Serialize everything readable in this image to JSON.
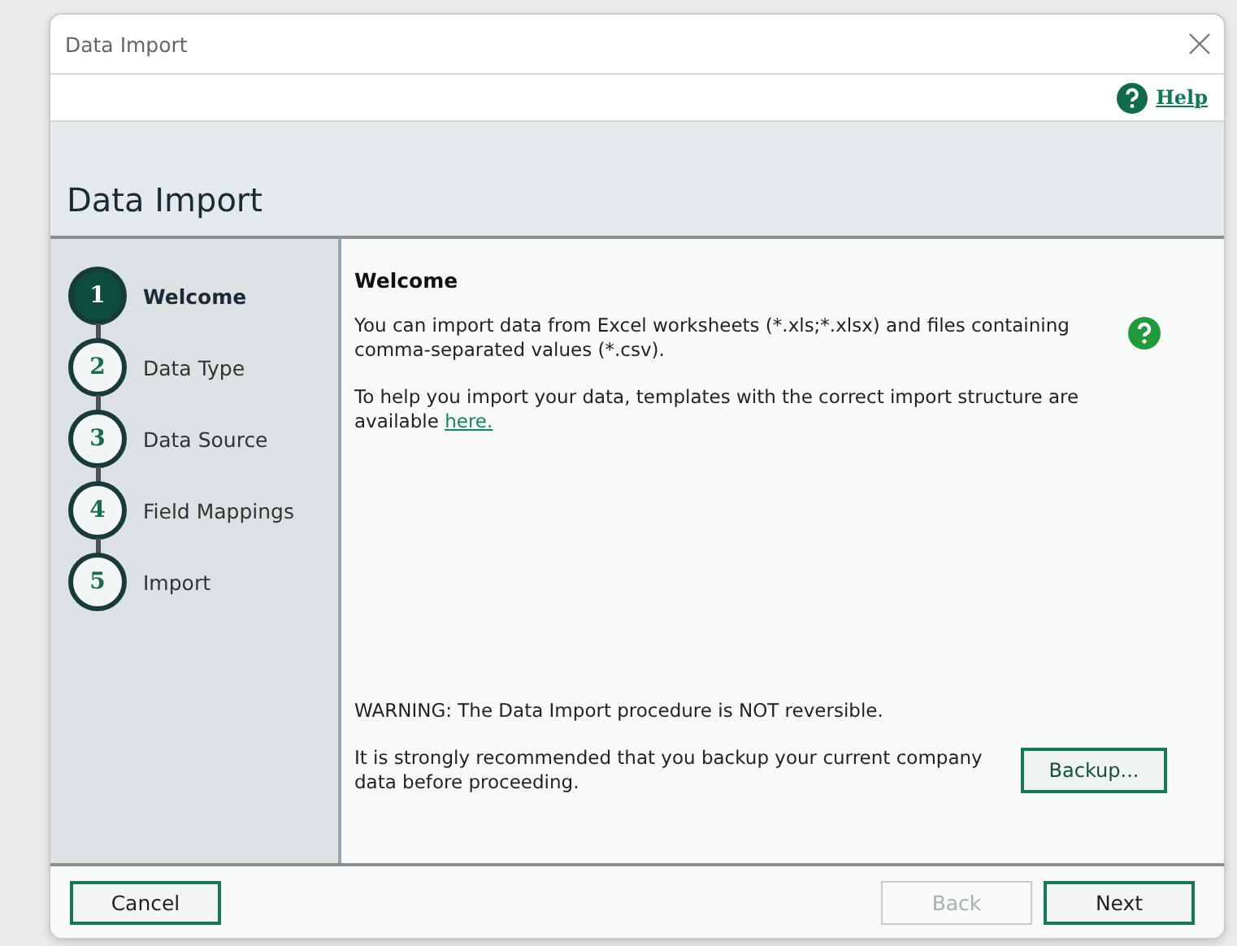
{
  "window": {
    "title": "Data Import"
  },
  "help_link": "Help",
  "header": {
    "title": "Data Import"
  },
  "steps": [
    {
      "number": "1",
      "label": "Welcome",
      "selected": true
    },
    {
      "number": "2",
      "label": "Data Type",
      "selected": false
    },
    {
      "number": "3",
      "label": "Data Source",
      "selected": false
    },
    {
      "number": "4",
      "label": "Field Mappings",
      "selected": false
    },
    {
      "number": "5",
      "label": "Import",
      "selected": false
    }
  ],
  "content": {
    "heading": "Welcome",
    "intro": "You can import data from Excel worksheets (*.xls;*.xlsx) and files containing comma-separated values (*.csv).",
    "templates_text": "To help you import your data, templates with the correct import structure are available ",
    "templates_link": "here.",
    "warning": "WARNING: The Data Import procedure is NOT reversible.",
    "recommendation": "It is strongly recommended that you backup your current company data before proceeding.",
    "backup_button": "Backup..."
  },
  "buttons": [
    {
      "label": "Cancel",
      "disabled": false
    },
    {
      "label": "Back",
      "disabled": true
    },
    {
      "label": "Next",
      "disabled": false
    }
  ]
}
